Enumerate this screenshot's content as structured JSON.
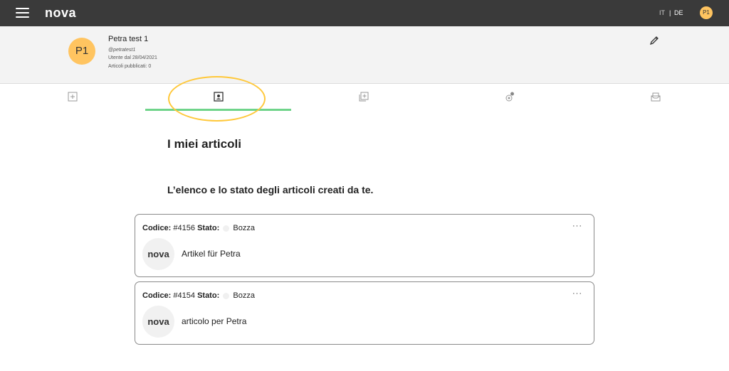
{
  "topbar": {
    "logo": "nova",
    "lang_it": "IT",
    "lang_sep": "|",
    "lang_de": "DE",
    "avatar_initials": "P1",
    "menu_icon": "hamburger-menu-icon"
  },
  "profile": {
    "initials": "P1",
    "name": "Petra test 1",
    "handle": "@petratest1",
    "since": "Utente dal 28/04/2021",
    "articles_count": "Articoli pubblicati: 0",
    "edit_icon": "pencil-icon"
  },
  "tabs": [
    {
      "icon": "add-square-icon",
      "active": false
    },
    {
      "icon": "profile-card-icon",
      "active": true
    },
    {
      "icon": "add-gallery-icon",
      "active": false
    },
    {
      "icon": "badge-medal-icon",
      "active": false
    },
    {
      "icon": "inbox-tray-icon",
      "active": false
    }
  ],
  "main": {
    "heading": "I miei articoli",
    "subheading": "L’elenco e lo stato degli articoli creati da te."
  },
  "articles": [
    {
      "code_label": "Codice:",
      "code": "#4156",
      "status_label": "Stato:",
      "status": "Bozza",
      "logo": "nova",
      "title": "Artikel für Petra",
      "more": "···"
    },
    {
      "code_label": "Codice:",
      "code": "#4154",
      "status_label": "Stato:",
      "status": "Bozza",
      "logo": "nova",
      "title": "articolo per Petra",
      "more": "···"
    }
  ],
  "colors": {
    "topbar": "#3a3a3a",
    "avatar": "#ffc460",
    "active_tab_underline": "#6fd48a",
    "highlight_ellipse": "#ffc83a"
  }
}
